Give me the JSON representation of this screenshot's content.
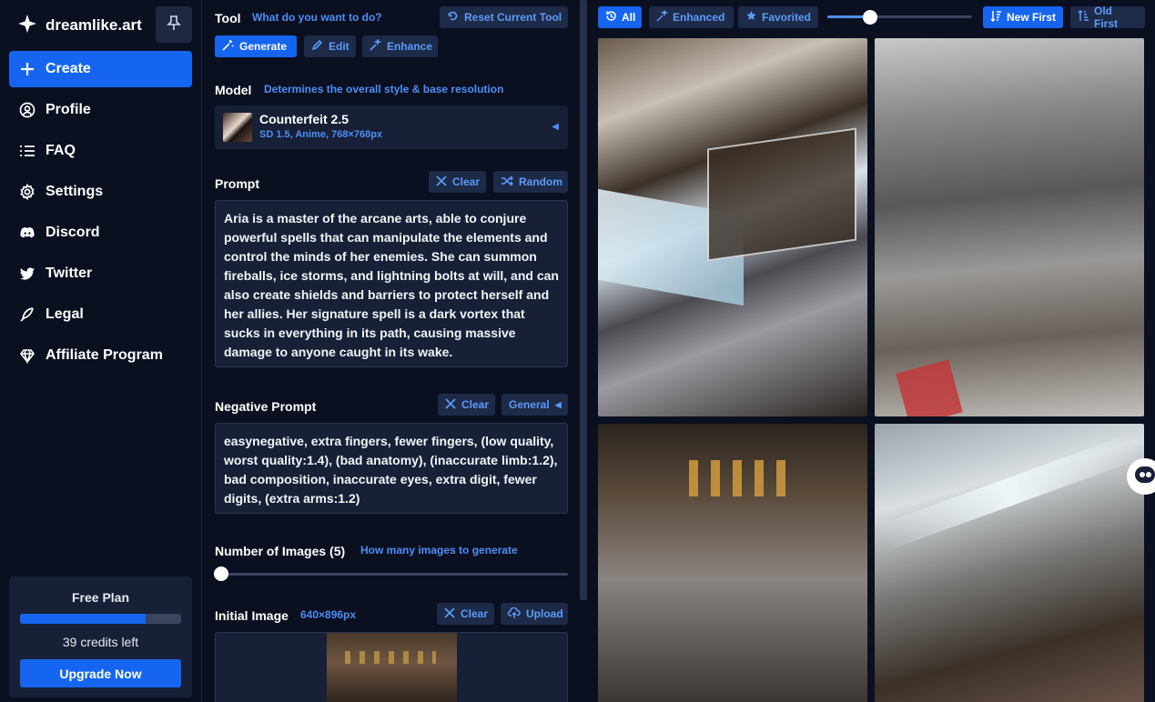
{
  "brand": {
    "name": "dreamlike.art"
  },
  "nav": [
    {
      "label": "Create",
      "icon": "plus-icon"
    },
    {
      "label": "Profile",
      "icon": "user-icon"
    },
    {
      "label": "FAQ",
      "icon": "list-icon"
    },
    {
      "label": "Settings",
      "icon": "gear-icon"
    },
    {
      "label": "Discord",
      "icon": "discord-icon"
    },
    {
      "label": "Twitter",
      "icon": "twitter-icon"
    },
    {
      "label": "Legal",
      "icon": "feather-icon"
    },
    {
      "label": "Affiliate Program",
      "icon": "diamond-icon"
    }
  ],
  "plan": {
    "title": "Free Plan",
    "credits": "39 credits left",
    "credits_fraction": 0.78,
    "upgrade_label": "Upgrade Now"
  },
  "tool": {
    "label": "Tool",
    "hint": "What do you want to do?",
    "reset_label": "Reset Current Tool",
    "tabs": [
      "Generate",
      "Edit",
      "Enhance"
    ]
  },
  "model": {
    "label": "Model",
    "hint": "Determines the overall style & base resolution",
    "name": "Counterfeit 2.5",
    "details": "SD 1.5, Anime, 768×768px"
  },
  "prompt": {
    "label": "Prompt",
    "clear_label": "Clear",
    "random_label": "Random",
    "text": "Aria is a master of the arcane arts, able to conjure powerful spells that can manipulate the elements and control the minds of her enemies. She can summon fireballs, ice storms, and lightning bolts at will, and can also create shields and barriers to protect herself and her allies. Her signature spell is a dark vortex that sucks in everything in its path, causing massive damage to anyone caught in its wake."
  },
  "negative": {
    "label": "Negative Prompt",
    "clear_label": "Clear",
    "preset_label": "General",
    "text": "easynegative, extra fingers, fewer fingers, (low quality, worst quality:1.4), (bad anatomy), (inaccurate limb:1.2), bad composition, inaccurate eyes, extra digit, fewer digits, (extra arms:1.2)"
  },
  "num_images": {
    "label": "Number of Images (5)",
    "hint": "How many images to generate"
  },
  "initial_image": {
    "label": "Initial Image",
    "size": "640×896px",
    "clear_label": "Clear",
    "upload_label": "Upload"
  },
  "gallery": {
    "filters": [
      "All",
      "Enhanced",
      "Favorited"
    ],
    "sort": [
      "New First",
      "Old First"
    ]
  },
  "colors": {
    "accent": "#1565f0",
    "link": "#4d8ef7",
    "panel": "#172036",
    "bg": "#0b1020"
  }
}
